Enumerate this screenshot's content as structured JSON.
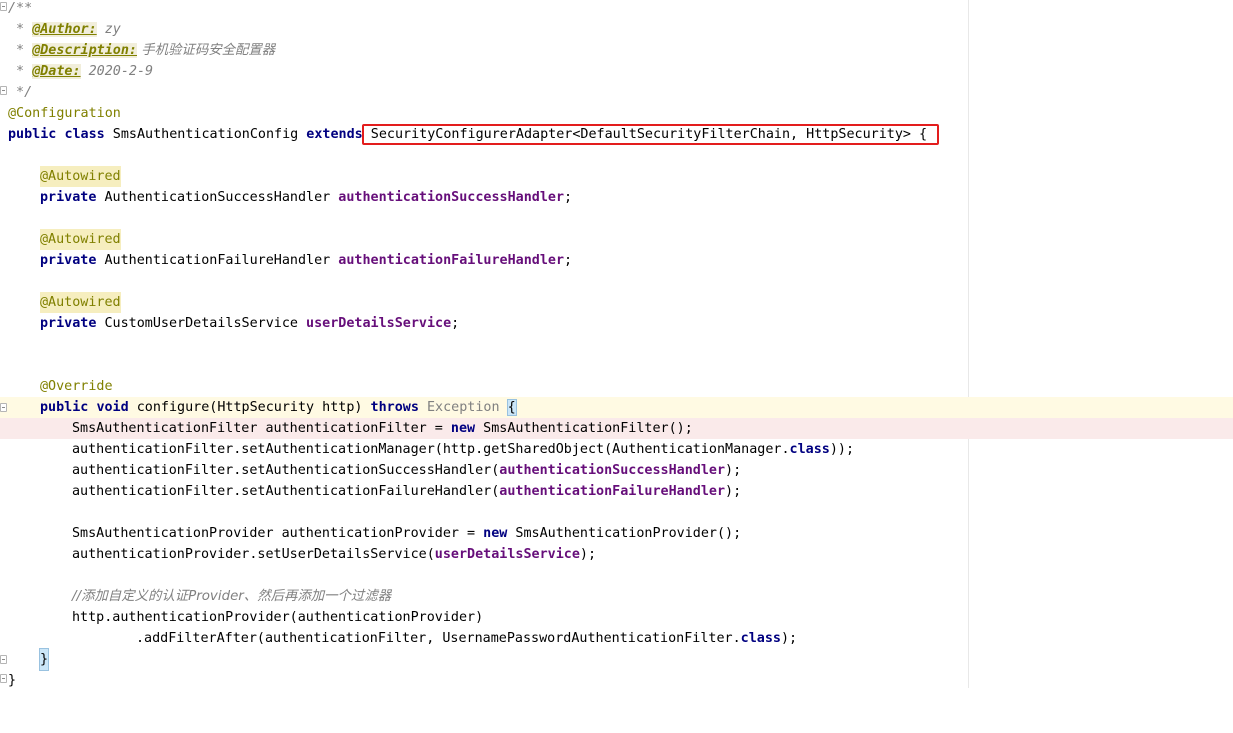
{
  "editor": {
    "lines": {
      "l1": "/**",
      "l2_star": " * ",
      "l2_tag": "@Author:",
      "l2_val": " zy",
      "l3_star": " * ",
      "l3_tag": "@Description:",
      "l3_val": " 手机验证码安全配置器",
      "l4_star": " * ",
      "l4_tag": "@Date:",
      "l4_val": " 2020-2-9",
      "l5": " */",
      "l6": "@Configuration",
      "l7_public": "public",
      "l7_class": "class",
      "l7_name": " SmsAuthenticationConfig ",
      "l7_extends": "extends",
      "l7_super": "SecurityConfigurerAdapter<DefaultSecurityFilterChain, HttpSecurity> {",
      "l9_anno": "@Autowired",
      "l10_private": "private",
      "l10_type": " AuthenticationSuccessHandler ",
      "l10_field": "authenticationSuccessHandler",
      "l10_end": ";",
      "l12_anno": "@Autowired",
      "l13_private": "private",
      "l13_type": " AuthenticationFailureHandler ",
      "l13_field": "authenticationFailureHandler",
      "l13_end": ";",
      "l15_anno": "@Autowired",
      "l16_private": "private",
      "l16_type": " CustomUserDetailsService ",
      "l16_field": "userDetailsService",
      "l16_end": ";",
      "l19_anno": "@Override",
      "l20_public": "public",
      "l20_void": "void",
      "l20_sig": " configure(HttpSecurity http) ",
      "l20_throws": "throws",
      "l20_exc": " Exception ",
      "l20_brace": "{",
      "l21_a": "SmsAuthenticationFilter authenticationFilter = ",
      "l21_new": "new",
      "l21_b": " SmsAuthenticationFilter();",
      "l22_a": "authenticationFilter.setAuthenticationManager(http.getSharedObject(AuthenticationManager.",
      "l22_class": "class",
      "l22_b": "));",
      "l23_a": "authenticationFilter.setAuthenticationSuccessHandler(",
      "l23_field": "authenticationSuccessHandler",
      "l23_b": ");",
      "l24_a": "authenticationFilter.setAuthenticationFailureHandler(",
      "l24_field": "authenticationFailureHandler",
      "l24_b": ");",
      "l26_a": "SmsAuthenticationProvider authenticationProvider = ",
      "l26_new": "new",
      "l26_b": " SmsAuthenticationProvider();",
      "l27_a": "authenticationProvider.setUserDetailsService(",
      "l27_field": "userDetailsService",
      "l27_b": ");",
      "l29": "//添加自定义的认证Provider、然后再添加一个过滤器",
      "l30": "http.authenticationProvider(authenticationProvider)",
      "l31_a": ".addFilterAfter(authenticationFilter, UsernamePasswordAuthenticationFilter.",
      "l31_class": "class",
      "l31_b": ");",
      "l32": "}",
      "l33": "}"
    }
  }
}
